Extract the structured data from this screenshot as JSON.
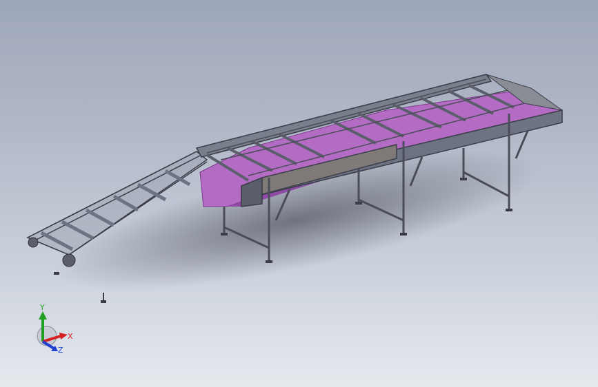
{
  "viewport": {
    "model": "belt-conveyor-assembly",
    "colors": {
      "background_top": "#9ea6ba",
      "background_bottom": "#e6e9ee",
      "frame": "#6e7383",
      "frame_dark": "#3a3d48",
      "belt": "#b36bc4",
      "belt_shade": "#8e4aa6",
      "rollers": "#8a8d96"
    }
  },
  "triad": {
    "x_label": "X",
    "y_label": "Y",
    "z_label": "Z",
    "x_color": "#d42020",
    "y_color": "#20a020",
    "z_color": "#2040d0"
  }
}
